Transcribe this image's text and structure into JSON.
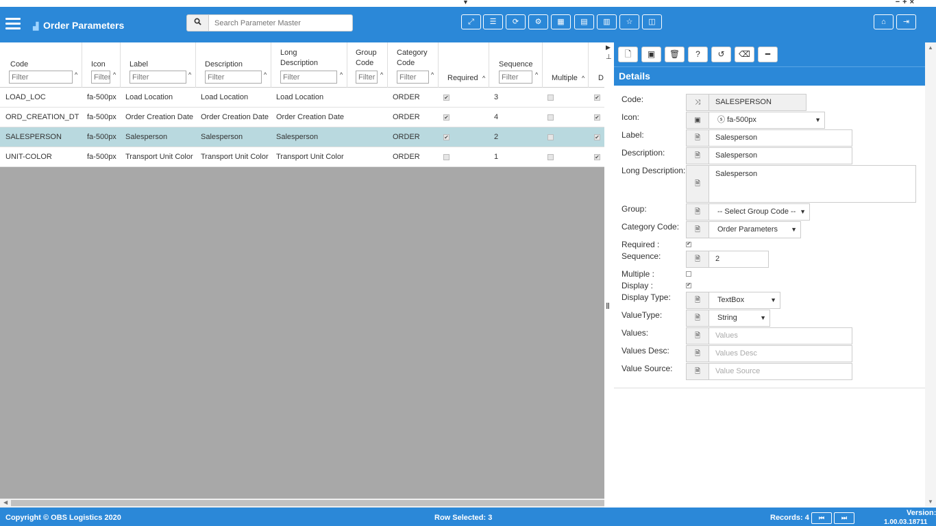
{
  "app": {
    "title": "Order Parameters"
  },
  "search": {
    "placeholder": "Search Parameter Master"
  },
  "grid": {
    "columns": {
      "code": "Code",
      "icon": "Icon",
      "label": "Label",
      "description": "Description",
      "long_description_1": "Long",
      "long_description_2": "Description",
      "group_code_1": "Group",
      "group_code_2": "Code",
      "category_code_1": "Category",
      "category_code_2": "Code",
      "required": "Required",
      "sequence": "Sequence",
      "multiple": "Multiple",
      "display": "D"
    },
    "filter_placeholder": "Filter",
    "rows": [
      {
        "code": "LOAD_LOC",
        "icon": "fa-500px",
        "label": "Load Location",
        "description": "Load Location",
        "long_description": "Load Location",
        "group_code": "",
        "category_code": "ORDER",
        "required": true,
        "sequence": "3",
        "multiple": false,
        "display": true
      },
      {
        "code": "ORD_CREATION_DT",
        "icon": "fa-500px",
        "label": "Order Creation Date",
        "description": "Order Creation Date",
        "long_description": "Order Creation Date",
        "group_code": "",
        "category_code": "ORDER",
        "required": true,
        "sequence": "4",
        "multiple": false,
        "display": true
      },
      {
        "code": "SALESPERSON",
        "icon": "fa-500px",
        "label": "Salesperson",
        "description": "Salesperson",
        "long_description": "Salesperson",
        "group_code": "",
        "category_code": "ORDER",
        "required": true,
        "sequence": "2",
        "multiple": false,
        "display": true
      },
      {
        "code": "UNIT-COLOR",
        "icon": "fa-500px",
        "label": "Transport Unit Color",
        "description": "Transport Unit Color",
        "long_description": "Transport Unit Color",
        "group_code": "",
        "category_code": "ORDER",
        "required": false,
        "sequence": "1",
        "multiple": false,
        "display": true
      }
    ]
  },
  "details": {
    "heading": "Details",
    "fields": {
      "code_label": "Code:",
      "code_value": "SALESPERSON",
      "icon_label": "Icon:",
      "icon_value": "fa-500px",
      "label_label": "Label:",
      "label_value": "Salesperson",
      "description_label": "Description:",
      "description_value": "Salesperson",
      "long_description_label": "Long Description:",
      "long_description_value": "Salesperson",
      "group_label": "Group:",
      "group_value": "-- Select Group Code --",
      "category_label": "Category Code:",
      "category_value": "Order Parameters",
      "required_label": "Required :",
      "required_checked": true,
      "sequence_label": "Sequence:",
      "sequence_value": "2",
      "multiple_label": "Multiple :",
      "multiple_checked": false,
      "display_label": "Display :",
      "display_checked": true,
      "display_type_label": "Display Type:",
      "display_type_value": "TextBox",
      "value_type_label": "ValueType:",
      "value_type_value": "String",
      "values_label": "Values:",
      "values_placeholder": "Values",
      "values_desc_label": "Values Desc:",
      "values_desc_placeholder": "Values Desc",
      "value_source_label": "Value Source:",
      "value_source_placeholder": "Value Source"
    }
  },
  "footer": {
    "copyright": "Copyright © OBS Logistics 2020",
    "row_selected": "Row Selected: 3",
    "records": "Records: 4",
    "version_label": "Version:",
    "version_value": "1.00.03.18711"
  },
  "colors": {
    "accent": "#2b88d8",
    "selected_row": "#b9d9df",
    "grid_empty": "#a8a8a8"
  }
}
